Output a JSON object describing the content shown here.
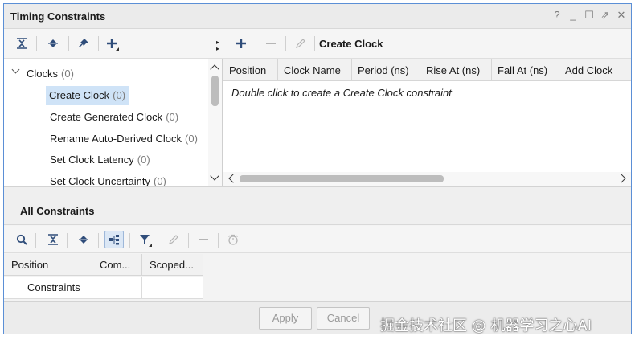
{
  "window": {
    "title": "Timing Constraints",
    "controls": [
      "?",
      "_",
      "☐",
      "⇗",
      "✕"
    ]
  },
  "tree": {
    "group": {
      "label": "Clocks",
      "count": "(0)"
    },
    "items": [
      {
        "label": "Create Clock",
        "count": "(0)",
        "selected": true
      },
      {
        "label": "Create Generated Clock",
        "count": "(0)"
      },
      {
        "label": "Rename Auto-Derived Clock",
        "count": "(0)"
      },
      {
        "label": "Set Clock Latency",
        "count": "(0)"
      },
      {
        "label": "Set Clock Uncertainty",
        "count": "(0)"
      }
    ]
  },
  "right_panel": {
    "title": "Create Clock",
    "columns": [
      "Position",
      "Clock Name",
      "Period (ns)",
      "Rise At (ns)",
      "Fall At (ns)",
      "Add Clock"
    ],
    "hint": "Double click to create a Create Clock constraint"
  },
  "all_constraints": {
    "title": "All Constraints",
    "columns": [
      "Position",
      "Com...",
      "Scoped..."
    ],
    "rows": [
      {
        "position": "Constraints",
        "comment": "",
        "scoped": ""
      }
    ]
  },
  "footer": {
    "apply_label": "Apply",
    "cancel_label": "Cancel",
    "watermark": "掘金技术社区 @ 机器学习之心AI"
  },
  "colors": {
    "accent_border": "#5b8fd6",
    "selection": "#cfe3f7",
    "icon": "#2f4d7a"
  }
}
